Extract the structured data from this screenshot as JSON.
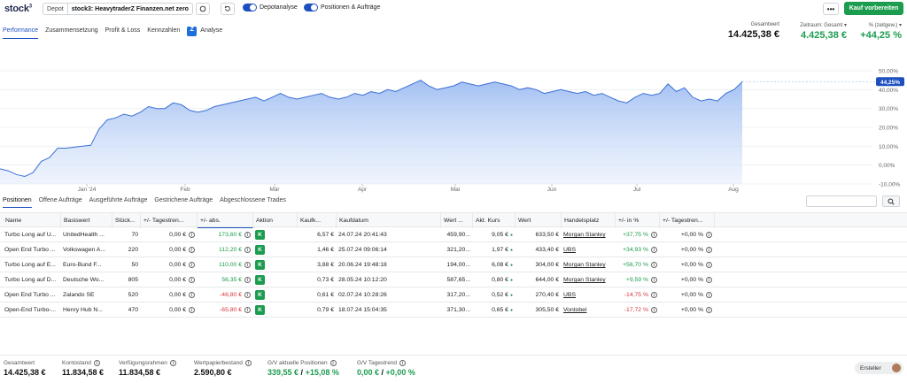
{
  "brand": {
    "name": "stock",
    "sup": "3"
  },
  "depot": {
    "label": "Depot",
    "value": "stock3: HeavytraderZ Finanzen.net zero"
  },
  "toggles": {
    "depotanalyse": "Depotanalyse",
    "positionen": "Positionen & Aufträge"
  },
  "actions": {
    "more": "•••",
    "buy": "Kauf vorbereiten"
  },
  "nav": {
    "tabs": [
      "Performance",
      "Zusammensetzung",
      "Profit & Loss",
      "Kennzahlen"
    ],
    "analyse": "Analyse"
  },
  "kpis": {
    "gesamtwert_label": "Gesamtwert",
    "gesamtwert": "14.425,38 €",
    "zeitraum_label": "Zeitraum: Gesamt",
    "zeitraum_value": "4.425,38 €",
    "pct_label": "% (zeitgew.)",
    "pct_value": "+44,25 %"
  },
  "chart_data": {
    "type": "area",
    "x_ticks": [
      "Jan '24",
      "Feb",
      "Mär",
      "Apr",
      "Mai",
      "Jun",
      "Jul",
      "Aug"
    ],
    "y_ticks": [
      "50,00%",
      "40,00%",
      "30,00%",
      "20,00%",
      "10,00%",
      "0,00%",
      "-10,00%"
    ],
    "ylim": [
      -10,
      50
    ],
    "current_label": "44,25%",
    "values": [
      -2,
      -3,
      -5,
      -6,
      -4,
      2,
      4,
      9,
      9,
      9.5,
      10,
      10.5,
      19,
      24,
      25,
      27,
      26,
      28,
      31,
      30,
      30,
      33,
      32,
      29,
      28,
      29,
      31,
      32,
      33,
      34,
      35,
      36,
      34,
      36,
      38,
      36,
      35,
      36,
      37,
      38,
      36,
      35,
      36,
      38,
      37,
      39,
      38,
      40,
      39,
      41,
      43,
      45,
      42,
      40,
      41,
      42,
      44,
      43,
      42,
      43,
      44,
      43,
      42,
      40,
      41,
      40,
      38,
      39,
      40,
      39,
      38,
      39,
      37,
      38,
      36,
      34,
      33,
      36,
      38,
      37,
      38,
      43,
      39,
      41,
      36,
      34,
      35,
      34,
      38,
      40,
      44.25
    ]
  },
  "subtabs": [
    "Positionen",
    "Offene Aufträge",
    "Ausgeführte Aufträge",
    "Gestrichene Aufträge",
    "Abgeschlossene Trades"
  ],
  "table": {
    "headers": [
      "Name",
      "Basiswert",
      "Stück...",
      "+/- Tagestren...",
      "+/- abs.",
      "Aktion",
      "Kaufk...",
      "Kaufdatum",
      "Wert ...",
      "Akt. Kurs",
      "Wert",
      "Handelsplatz",
      "+/- in %",
      "+/- Tagestren..."
    ],
    "rows": [
      {
        "name": "Turbo Long auf U...",
        "basis": "UnitedHealth ...",
        "stk": "70",
        "tag": "0,00 €",
        "abs": "173,60 €",
        "abs_pos": true,
        "aktion": "K",
        "kk": "6,57 €",
        "datum": "24.07.24 20:41:43",
        "wert1": "459,90...",
        "kurs": "9,05 €",
        "wert": "633,50 €",
        "platz": "Morgan Stanley",
        "pct": "+37,75 %",
        "pct_pos": true,
        "tag2": "+0,00 %"
      },
      {
        "name": "Open End Turbo ...",
        "basis": "Volkswagen A...",
        "stk": "220",
        "tag": "0,00 €",
        "abs": "112,20 €",
        "abs_pos": true,
        "aktion": "K",
        "kk": "1,46 €",
        "datum": "25.07.24 09:06:14",
        "wert1": "321,20...",
        "kurs": "1,97 €",
        "wert": "433,40 €",
        "platz": "UBS",
        "pct": "+34,93 %",
        "pct_pos": true,
        "tag2": "+0,00 %"
      },
      {
        "name": "Turbo Long auf E...",
        "basis": "Euro-Bund F...",
        "stk": "50",
        "tag": "0,00 €",
        "abs": "110,00 €",
        "abs_pos": true,
        "aktion": "K",
        "kk": "3,88 €",
        "datum": "20.06.24 19:48:18",
        "wert1": "194,00...",
        "kurs": "6,08 €",
        "wert": "304,00 €",
        "platz": "Morgan Stanley",
        "pct": "+56,70 %",
        "pct_pos": true,
        "tag2": "+0,00 %"
      },
      {
        "name": "Turbo Long auf D...",
        "basis": "Deutsche Wo...",
        "stk": "805",
        "tag": "0,00 €",
        "abs": "56,35 €",
        "abs_pos": true,
        "aktion": "K",
        "kk": "0,73 €",
        "datum": "28.05.24 10:12:20",
        "wert1": "587,65...",
        "kurs": "0,80 €",
        "wert": "644,00 €",
        "platz": "Morgan Stanley",
        "pct": "+9,59 %",
        "pct_pos": true,
        "tag2": "+0,00 %"
      },
      {
        "name": "Open End Turbo ...",
        "basis": "Zalando SE",
        "stk": "520",
        "tag": "0,00 €",
        "abs": "-46,80 €",
        "abs_pos": false,
        "aktion": "K",
        "kk": "0,61 €",
        "datum": "02.07.24 10:28:26",
        "wert1": "317,20...",
        "kurs": "0,52 €",
        "wert": "270,40 €",
        "platz": "UBS",
        "pct": "-14,75 %",
        "pct_pos": false,
        "tag2": "+0,00 %"
      },
      {
        "name": "Open-End Turbo-...",
        "basis": "Henry Hub N...",
        "stk": "470",
        "tag": "0,00 €",
        "abs": "-65,80 €",
        "abs_pos": false,
        "aktion": "K",
        "kk": "0,79 €",
        "datum": "18.07.24 15:04:35",
        "wert1": "371,30...",
        "kurs": "0,65 €",
        "wert": "305,50 €",
        "platz": "Vontobel",
        "pct": "-17,72 %",
        "pct_pos": false,
        "tag2": "+0,00 %"
      }
    ]
  },
  "footer": {
    "gesamtwert_label": "Gesamtwert",
    "gesamtwert": "14.425,38 €",
    "konto_label": "Kontostand",
    "konto": "11.834,58 €",
    "verf_label": "Verfügungsrahmen",
    "verf": "11.834,58 €",
    "wp_label": "Wertpapierbestand",
    "wp": "2.590,80 €",
    "gv_label": "G/V aktuelle Positionen",
    "gv_abs": "339,55 €",
    "gv_pct": "+15,08 %",
    "gvt_label": "G/V Tagestrend",
    "gvt_abs": "0,00 €",
    "gvt_pct": "+0,00 %",
    "creator": "Ersteller"
  },
  "search": {
    "placeholder": ""
  },
  "colors": {
    "accent": "#1e4fbf",
    "green": "#1c9c4f",
    "red": "#d9363e",
    "area": "#9ebdf2"
  }
}
